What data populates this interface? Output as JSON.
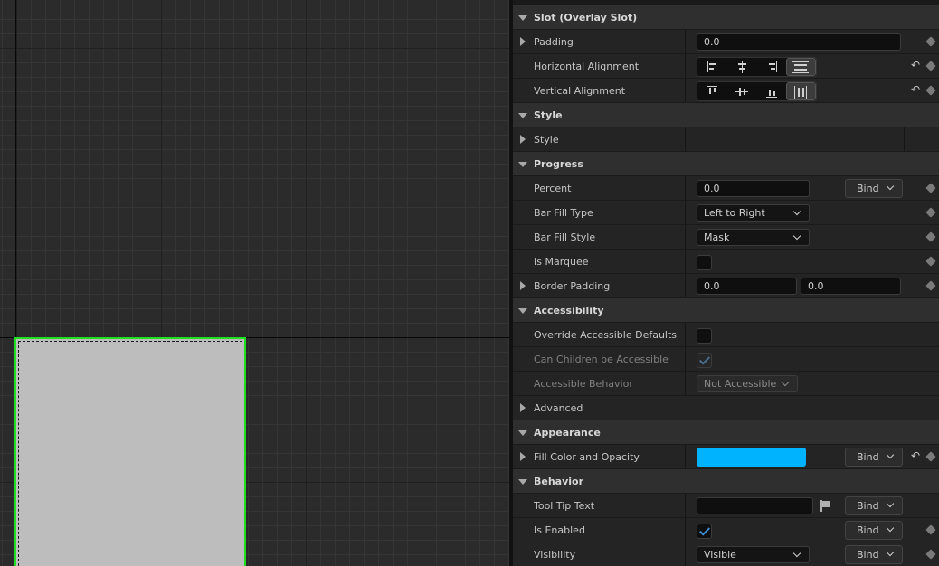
{
  "colors": {
    "accent_green": "#1ee01e",
    "fill_color": "#00b3ff",
    "check_blue": "#3d8fd8",
    "panel_bg": "#1c1c1c",
    "category_bg": "#2f2f2f"
  },
  "viewport": {
    "widget_fill": "#bdbdbd"
  },
  "details": {
    "slot": {
      "header": "Slot (Overlay Slot)",
      "padding_label": "Padding",
      "padding_value": "0.0",
      "h_align_label": "Horizontal Alignment",
      "h_align_selected": "Fill",
      "v_align_label": "Vertical Alignment",
      "v_align_selected": "Fill"
    },
    "style": {
      "header": "Style",
      "style_label": "Style"
    },
    "progress": {
      "header": "Progress",
      "percent_label": "Percent",
      "percent_value": "0.0",
      "bind_label": "Bind",
      "bar_fill_type_label": "Bar Fill Type",
      "bar_fill_type_value": "Left to Right",
      "bar_fill_style_label": "Bar Fill Style",
      "bar_fill_style_value": "Mask",
      "is_marquee_label": "Is Marquee",
      "is_marquee_checked": false,
      "border_padding_label": "Border Padding",
      "border_padding_x": "0.0",
      "border_padding_y": "0.0"
    },
    "accessibility": {
      "header": "Accessibility",
      "override_label": "Override Accessible Defaults",
      "override_checked": false,
      "children_label": "Can Children be Accessible",
      "children_checked": true,
      "behavior_label": "Accessible Behavior",
      "behavior_value": "Not Accessible"
    },
    "advanced": {
      "label": "Advanced"
    },
    "appearance": {
      "header": "Appearance",
      "fill_label": "Fill Color and Opacity",
      "bind_label": "Bind"
    },
    "behavior": {
      "header": "Behavior",
      "tooltip_label": "Tool Tip Text",
      "tooltip_value": "",
      "is_enabled_label": "Is Enabled",
      "is_enabled_checked": true,
      "visibility_label": "Visibility",
      "visibility_value": "Visible",
      "bind_label": "Bind"
    }
  }
}
